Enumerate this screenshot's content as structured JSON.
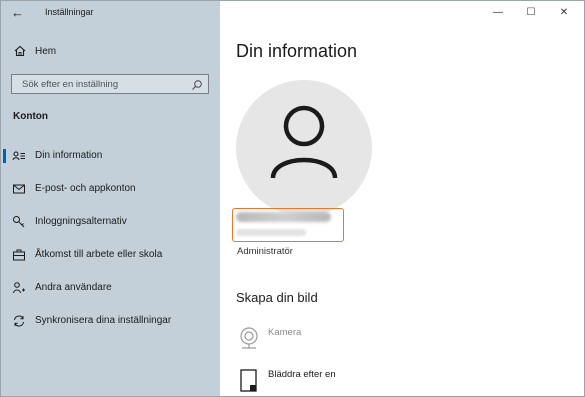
{
  "window": {
    "title": "Inställningar",
    "controls": {
      "minimize": "—",
      "maximize": "☐",
      "close": "✕"
    }
  },
  "sidebar": {
    "back_label": "←",
    "home_label": "Hem",
    "search": {
      "placeholder": "Sök efter en inställning"
    },
    "section_title": "Konton",
    "items": [
      {
        "label": "Din information",
        "icon": "user-info-icon",
        "selected": true
      },
      {
        "label": "E-post- och appkonton",
        "icon": "mail-icon",
        "selected": false
      },
      {
        "label": "Inloggningsalternativ",
        "icon": "key-icon",
        "selected": false
      },
      {
        "label": "Åtkomst till arbete eller skola",
        "icon": "briefcase-icon",
        "selected": false
      },
      {
        "label": "Andra användare",
        "icon": "person-add-icon",
        "selected": false
      },
      {
        "label": "Synkronisera dina inställningar",
        "icon": "sync-icon",
        "selected": false
      }
    ]
  },
  "main": {
    "page_title": "Din information",
    "account_role": "Administratör",
    "create_picture_title": "Skapa din bild",
    "actions": [
      {
        "label": "Kamera",
        "icon": "camera-icon",
        "enabled": false
      },
      {
        "label": "Bläddra efter en",
        "icon": "browse-file-icon",
        "enabled": true
      }
    ]
  },
  "colors": {
    "sidebar_bg": "#c3cfd9",
    "accent": "#0063b1",
    "highlight_box": "#e8772e"
  }
}
